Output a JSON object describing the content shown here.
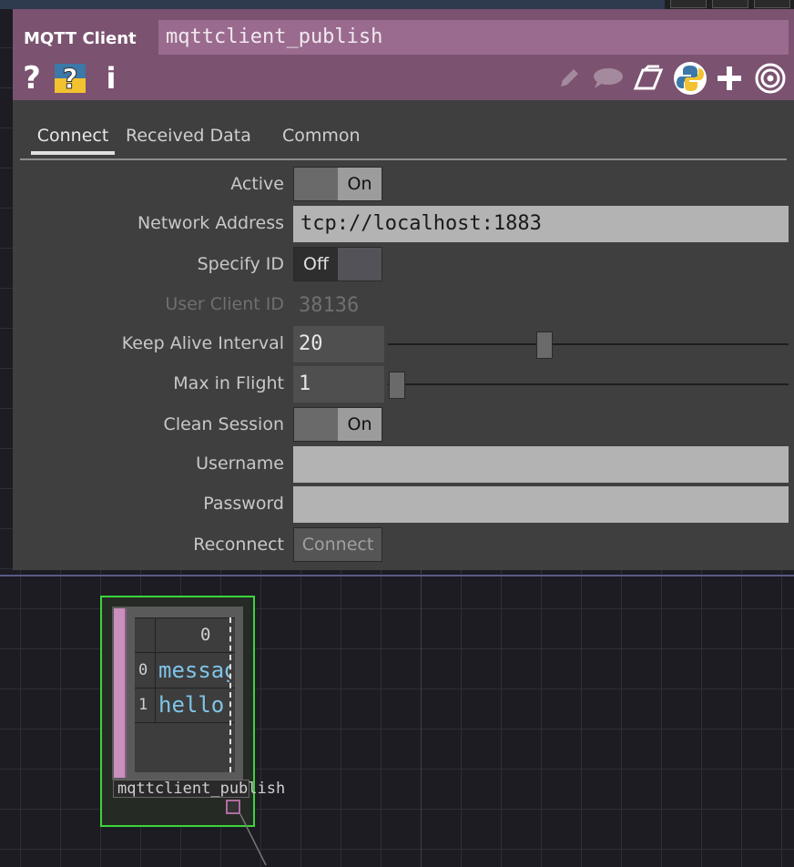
{
  "op_type": "MQTT Client",
  "op_name": "mqttclient_publish",
  "header_icons": [
    "help-icon",
    "python-help-icon",
    "info-icon",
    "edit-icon",
    "comment-icon",
    "clone-icon",
    "python-icon",
    "add-icon",
    "target-icon"
  ],
  "help_glyph": "?",
  "info_glyph": "i",
  "tabs": [
    "Connect",
    "Received Data",
    "Common"
  ],
  "params": {
    "active": {
      "label": "Active",
      "value": "On"
    },
    "network_address": {
      "label": "Network Address",
      "value": "tcp://localhost:1883"
    },
    "specify_id": {
      "label": "Specify ID",
      "value": "Off"
    },
    "user_client_id": {
      "label": "User Client ID",
      "value": "38136"
    },
    "keep_alive": {
      "label": "Keep Alive Interval",
      "value": "20"
    },
    "max_in_flight": {
      "label": "Max in Flight",
      "value": "1"
    },
    "clean_session": {
      "label": "Clean Session",
      "value": "On"
    },
    "username": {
      "label": "Username",
      "value": ""
    },
    "password": {
      "label": "Password",
      "value": ""
    },
    "reconnect": {
      "label": "Reconnect",
      "button": "Connect"
    }
  },
  "node": {
    "name": "mqttclient_publish",
    "header": "0",
    "rows": [
      {
        "index": "0",
        "value": "messag"
      },
      {
        "index": "1",
        "value": "hello"
      }
    ]
  },
  "colors": {
    "header": "#7b5270",
    "panel": "#3f3f3f",
    "selection": "#3ad63a",
    "cell_text": "#7fc4e8"
  }
}
